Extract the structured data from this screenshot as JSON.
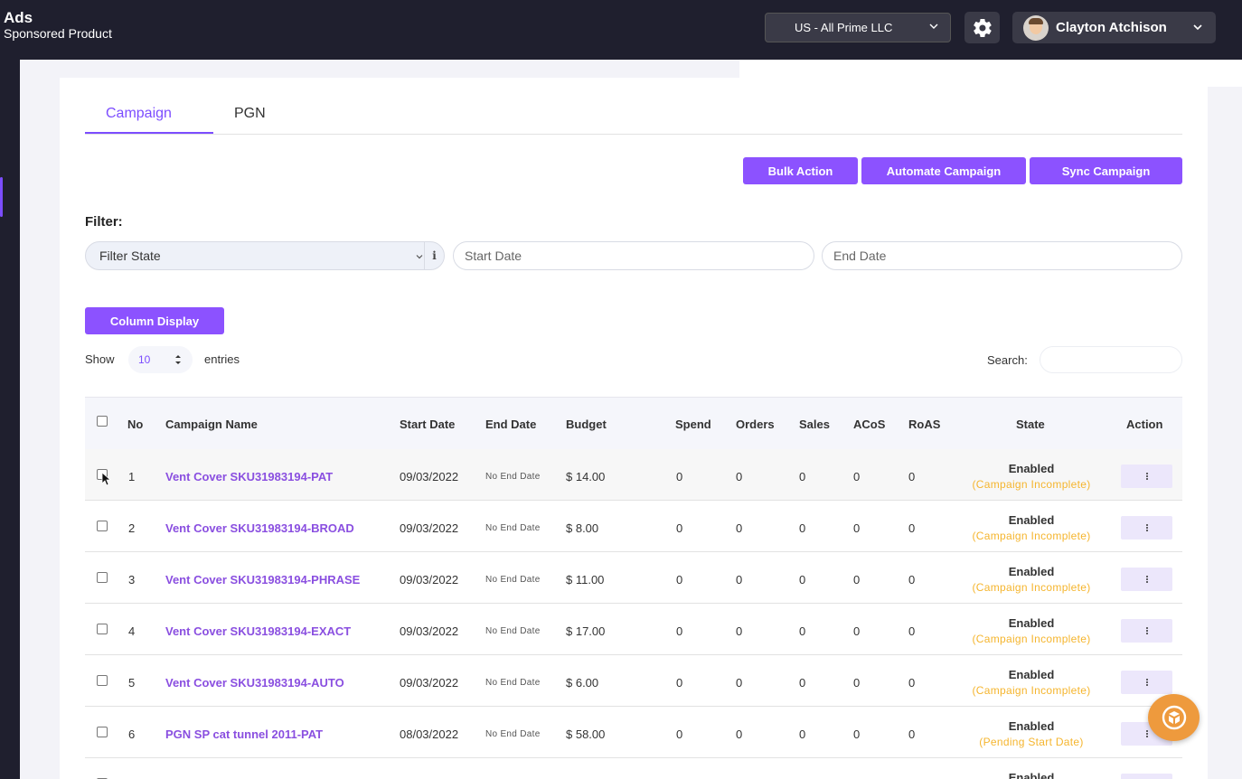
{
  "header": {
    "app_title": "Ads",
    "app_subtitle": "Sponsored Product",
    "account": "US - All Prime LLC",
    "user_name": "Clayton Atchison"
  },
  "tabs": [
    {
      "label": "Campaign",
      "active": true
    },
    {
      "label": "PGN",
      "active": false
    }
  ],
  "actions": {
    "bulk": "Bulk Action",
    "automate": "Automate Campaign",
    "sync": "Sync Campaign",
    "column_display": "Column Display"
  },
  "filter": {
    "label": "Filter:",
    "state_placeholder": "Filter State",
    "info_icon": "i",
    "start_date_placeholder": "Start Date",
    "end_date_placeholder": "End Date"
  },
  "entries": {
    "show": "Show",
    "value": "10",
    "suffix": "entries",
    "search_label": "Search:"
  },
  "table": {
    "columns": [
      "No",
      "Campaign Name",
      "Start Date",
      "End Date",
      "Budget",
      "Spend",
      "Orders",
      "Sales",
      "ACoS",
      "RoAS",
      "State",
      "Action"
    ],
    "rows": [
      {
        "no": "1",
        "name": "Vent Cover SKU31983194-PAT",
        "start": "09/03/2022",
        "end": "No End Date",
        "budget": "$ 14.00",
        "spend": "0",
        "orders": "0",
        "sales": "0",
        "acos": "0",
        "roas": "0",
        "state": "Enabled",
        "state_note": "(Campaign Incomplete)"
      },
      {
        "no": "2",
        "name": "Vent Cover SKU31983194-BROAD",
        "start": "09/03/2022",
        "end": "No End Date",
        "budget": "$ 8.00",
        "spend": "0",
        "orders": "0",
        "sales": "0",
        "acos": "0",
        "roas": "0",
        "state": "Enabled",
        "state_note": "(Campaign Incomplete)"
      },
      {
        "no": "3",
        "name": "Vent Cover SKU31983194-PHRASE",
        "start": "09/03/2022",
        "end": "No End Date",
        "budget": "$ 11.00",
        "spend": "0",
        "orders": "0",
        "sales": "0",
        "acos": "0",
        "roas": "0",
        "state": "Enabled",
        "state_note": "(Campaign Incomplete)"
      },
      {
        "no": "4",
        "name": "Vent Cover SKU31983194-EXACT",
        "start": "09/03/2022",
        "end": "No End Date",
        "budget": "$ 17.00",
        "spend": "0",
        "orders": "0",
        "sales": "0",
        "acos": "0",
        "roas": "0",
        "state": "Enabled",
        "state_note": "(Campaign Incomplete)"
      },
      {
        "no": "5",
        "name": "Vent Cover SKU31983194-AUTO",
        "start": "09/03/2022",
        "end": "No End Date",
        "budget": "$ 6.00",
        "spend": "0",
        "orders": "0",
        "sales": "0",
        "acos": "0",
        "roas": "0",
        "state": "Enabled",
        "state_note": "(Campaign Incomplete)"
      },
      {
        "no": "6",
        "name": "PGN SP cat tunnel 2011-PAT",
        "start": "08/03/2022",
        "end": "No End Date",
        "budget": "$ 58.00",
        "spend": "0",
        "orders": "0",
        "sales": "0",
        "acos": "0",
        "roas": "0",
        "state": "Enabled",
        "state_note": "(Pending Start Date)"
      },
      {
        "no": "",
        "name": "",
        "start": "",
        "end": "",
        "budget": "",
        "spend": "",
        "orders": "",
        "sales": "",
        "acos": "",
        "roas": "",
        "state": "Enabled",
        "state_note": ""
      }
    ]
  },
  "colors": {
    "accent": "#8c52ff",
    "topbar": "#1f1f2e",
    "status_note": "#f5b52e",
    "chat_button": "#ee9a3d"
  },
  "icons": [
    "chevron-down-icon",
    "gear-icon",
    "avatar",
    "info-icon",
    "sort-updown-icon",
    "kebab-menu-icon",
    "cursor-icon",
    "chat-widget-icon"
  ]
}
